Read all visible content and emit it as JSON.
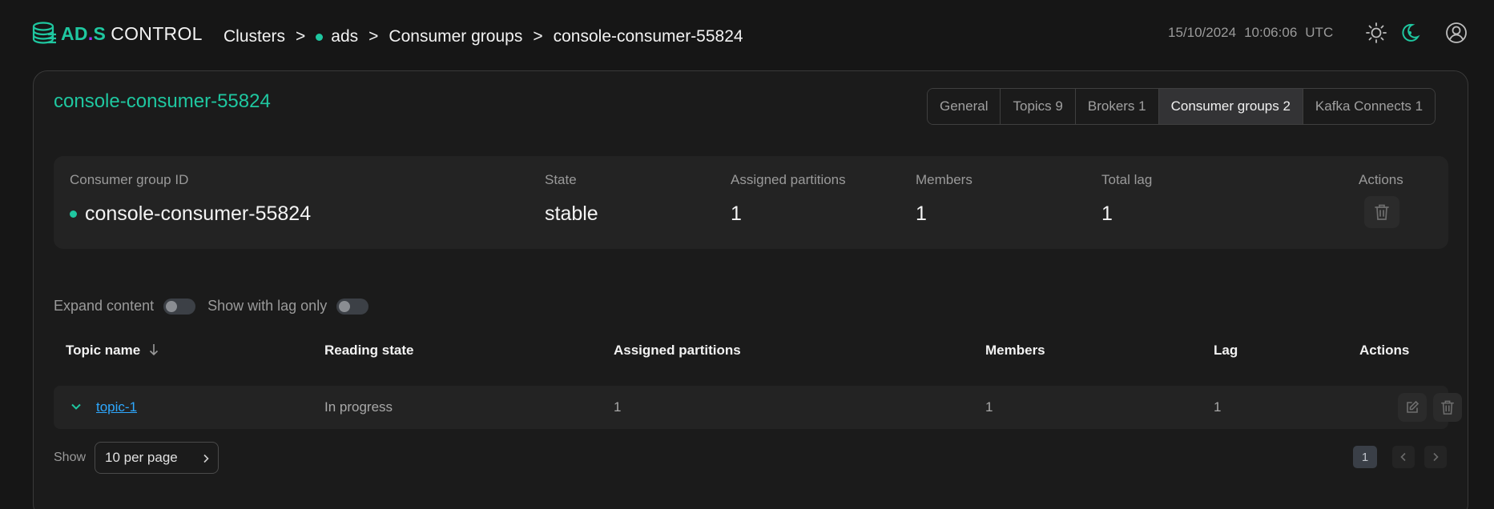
{
  "logo": {
    "brand_ad": "AD",
    "brand_dot": ".",
    "brand_s": "S",
    "brand_control": "CONTROL"
  },
  "breadcrumb": [
    {
      "label": "Clusters"
    },
    {
      "label": "ads",
      "status_dot": true
    },
    {
      "label": "Consumer groups"
    },
    {
      "label": "console-consumer-55824"
    }
  ],
  "breadcrumb_separator": ">",
  "header": {
    "date": "15/10/2024",
    "time": "10:06:06",
    "timezone": "UTC"
  },
  "page": {
    "title": "console-consumer-55824"
  },
  "tabs": [
    {
      "label": "General",
      "active": false
    },
    {
      "label": "Topics 9",
      "active": false
    },
    {
      "label": "Brokers 1",
      "active": false
    },
    {
      "label": "Consumer groups 2",
      "active": true
    },
    {
      "label": "Kafka Connects 1",
      "active": false
    }
  ],
  "summary": {
    "group_id_label": "Consumer group ID",
    "group_id_value": "console-consumer-55824",
    "state_label": "State",
    "state_value": "stable",
    "assigned_label": "Assigned partitions",
    "assigned_value": "1",
    "members_label": "Members",
    "members_value": "1",
    "lag_label": "Total lag",
    "lag_value": "1",
    "actions_label": "Actions"
  },
  "toggles": {
    "expand_label": "Expand content",
    "lag_only_label": "Show with lag only"
  },
  "table": {
    "headers": {
      "topic": "Topic name",
      "reading_state": "Reading state",
      "assigned": "Assigned partitions",
      "members": "Members",
      "lag": "Lag",
      "actions": "Actions"
    },
    "rows": [
      {
        "topic": "topic-1",
        "reading_state": "In progress",
        "assigned": "1",
        "members": "1",
        "lag": "1"
      }
    ]
  },
  "pagination": {
    "show_label": "Show",
    "per_page": "10 per page",
    "current_page": "1"
  },
  "colors": {
    "accent": "#1fc7a0",
    "link": "#2ea8ff",
    "brand_dot": "#9b30ff"
  }
}
